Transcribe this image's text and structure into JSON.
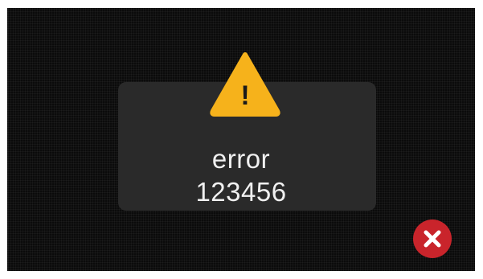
{
  "dialog": {
    "title": "error",
    "code": "123456",
    "icon": "warning-icon",
    "icon_glyph": "!"
  },
  "close_button": {
    "icon": "close-icon"
  },
  "colors": {
    "background": "#0b0b0b",
    "dialog_background": "#2a2a2a",
    "warning_accent": "#f6b21b",
    "close_accent": "#c9242b",
    "text": "#f0f0f0"
  }
}
